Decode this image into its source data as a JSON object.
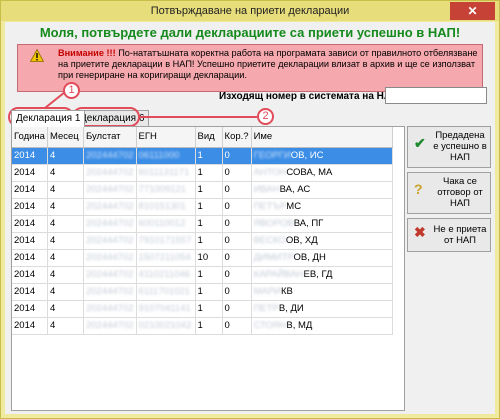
{
  "window": {
    "title": "Потвърждаване на приети декларации",
    "close_glyph": "✕"
  },
  "heading": "Моля, потвърдете дали декларациите са приети успешно в НАП!",
  "warning": {
    "icon": "warning-icon",
    "strong": "Внимание !!!",
    "text": " По-нататъшната коректна работа на програмата зависи от правилното отбелязване на приетите декларации в НАП! Успешно приетите декларации влизат в архив и ще се използват при генериране на коригиращи декларации."
  },
  "outgoing": {
    "label": "Изходящ номер в системата на НАП:",
    "value": ""
  },
  "tabs": [
    {
      "label": "Декларация 1"
    },
    {
      "label": "Декларация 6"
    }
  ],
  "callouts": [
    "1",
    "2"
  ],
  "grid": {
    "columns": [
      "Година",
      "Месец",
      "Булстат",
      "ЕГН",
      "Вид",
      "Кор.?",
      "Име"
    ],
    "rows": [
      [
        "2014",
        "4",
        "202444702",
        "06111000",
        "1",
        "0",
        "ОВ, ИС"
      ],
      [
        "2014",
        "4",
        "202444702",
        "6011131171",
        "1",
        "0",
        "СОВА, МА"
      ],
      [
        "2014",
        "4",
        "202444702",
        "771009121",
        "1",
        "0",
        "ВА, АС"
      ],
      [
        "2014",
        "4",
        "202444702",
        "810151301",
        "1",
        "0",
        "МС"
      ],
      [
        "2014",
        "4",
        "202444702",
        "600110012",
        "1",
        "0",
        "ВА, ПГ"
      ],
      [
        "2014",
        "4",
        "202444702",
        "7910171557",
        "1",
        "0",
        "ОВ, ХД"
      ],
      [
        "2014",
        "4",
        "202444702",
        "1507211054",
        "10",
        "0",
        "ОВ, ДН"
      ],
      [
        "2014",
        "4",
        "202444702",
        "4110211046",
        "1",
        "0",
        "ЕВ, ГД"
      ],
      [
        "2014",
        "4",
        "202444702",
        "6111701021",
        "1",
        "0",
        "КВ"
      ],
      [
        "2014",
        "4",
        "202444702",
        "9107041141",
        "1",
        "0",
        "В, ДИ"
      ],
      [
        "2014",
        "4",
        "202444702",
        "0210021042",
        "1",
        "0",
        "В, МД"
      ]
    ],
    "name_prefixes": [
      "ГЕОРГИ",
      "АНТОН",
      "ИВАН",
      "ПЕТЪР",
      "ЯВОРОВ",
      "ВЕСКО",
      "ДИМИТР",
      "КАРАЙВАН",
      "МАРИ",
      "ПЕТР",
      "СТОЯН"
    ]
  },
  "buttons": [
    {
      "label": "Предадена е успешно в НАП",
      "icon": "checkmark-icon",
      "glyph": "✔",
      "color": "#1f8a2e"
    },
    {
      "label": "Чака се отговор от НАП",
      "icon": "question-icon",
      "glyph": "?",
      "color": "#c9a227"
    },
    {
      "label": "Не е приета от НАП",
      "icon": "cross-icon",
      "glyph": "✖",
      "color": "#c0392b"
    }
  ],
  "colors": {
    "heading": "#158a1c",
    "warning_bg": "#f5a8ad",
    "selection": "#3b8de6",
    "annotation": "#e14b5a"
  }
}
